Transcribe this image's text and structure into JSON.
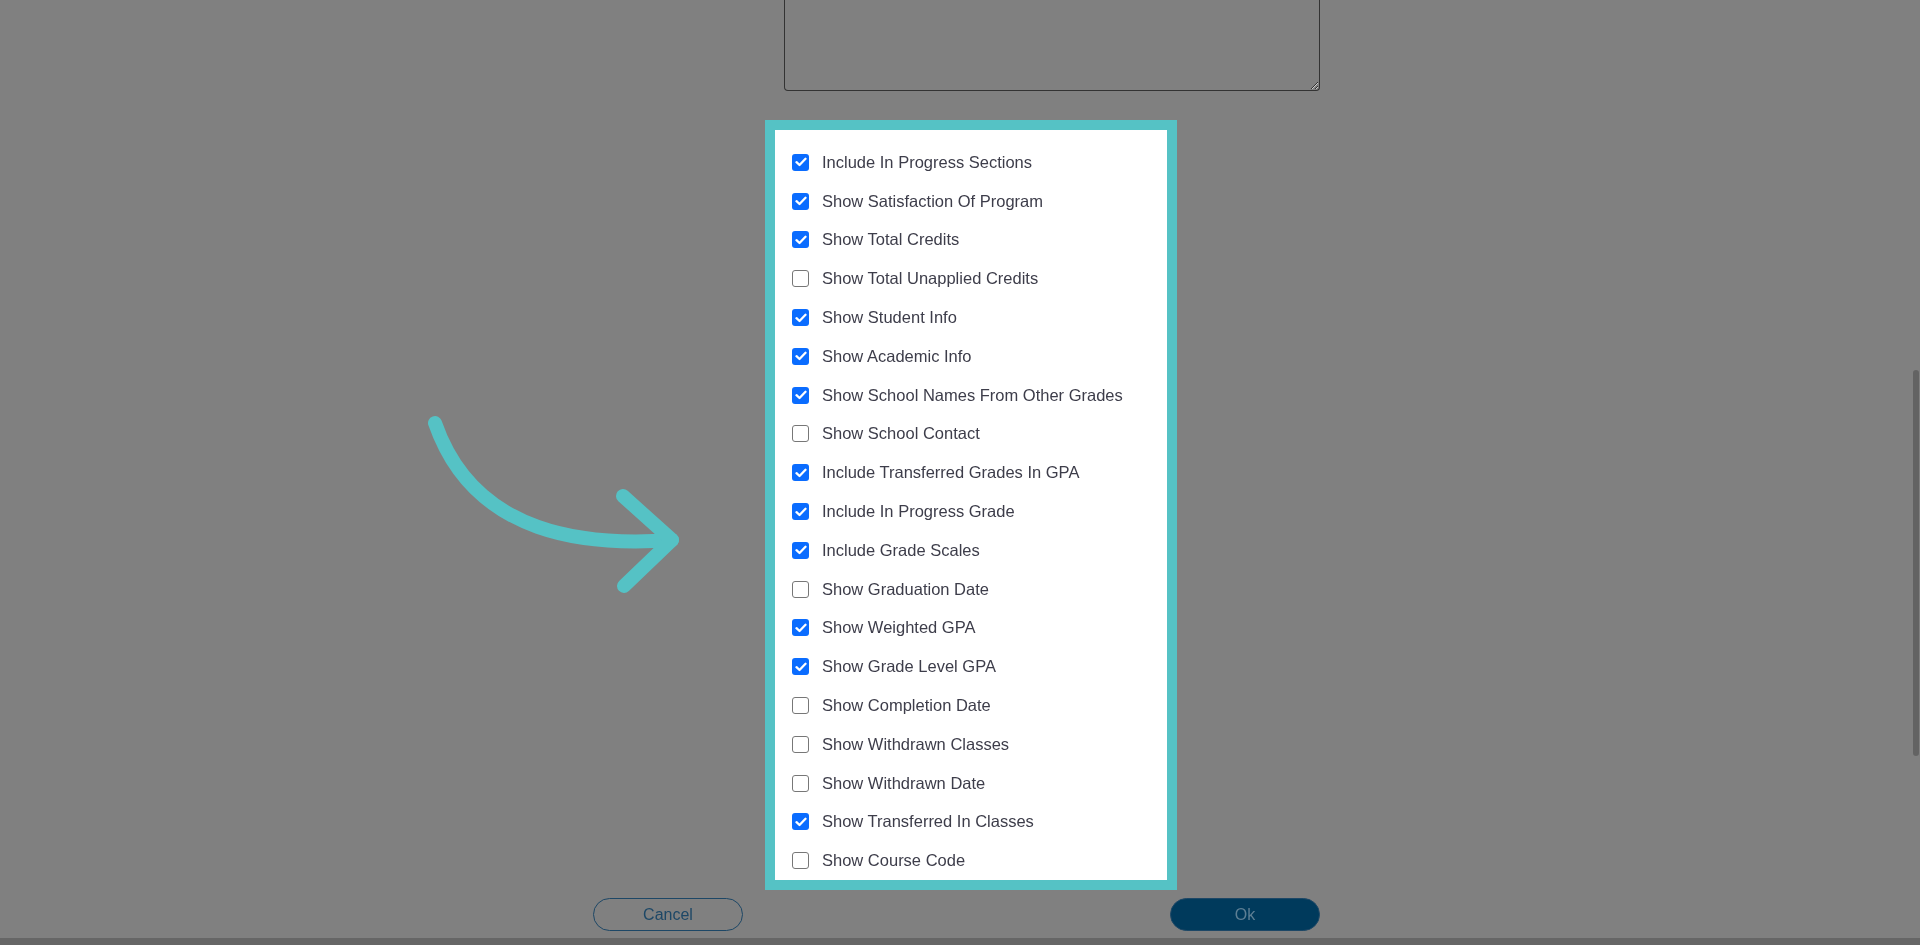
{
  "options": [
    {
      "label": "Include In Progress Sections",
      "checked": true
    },
    {
      "label": "Show Satisfaction Of Program",
      "checked": true
    },
    {
      "label": "Show Total Credits",
      "checked": true
    },
    {
      "label": "Show Total Unapplied Credits",
      "checked": false
    },
    {
      "label": "Show Student Info",
      "checked": true
    },
    {
      "label": "Show Academic Info",
      "checked": true
    },
    {
      "label": "Show School Names From Other Grades",
      "checked": true
    },
    {
      "label": "Show School Contact",
      "checked": false
    },
    {
      "label": "Include Transferred Grades In GPA",
      "checked": true
    },
    {
      "label": "Include In Progress Grade",
      "checked": true
    },
    {
      "label": "Include Grade Scales",
      "checked": true
    },
    {
      "label": "Show Graduation Date",
      "checked": false
    },
    {
      "label": "Show Weighted GPA",
      "checked": true
    },
    {
      "label": "Show Grade Level GPA",
      "checked": true
    },
    {
      "label": "Show Completion Date",
      "checked": false
    },
    {
      "label": "Show Withdrawn Classes",
      "checked": false
    },
    {
      "label": "Show Withdrawn Date",
      "checked": false
    },
    {
      "label": "Show Transferred In Classes",
      "checked": true
    },
    {
      "label": "Show Course Code",
      "checked": false
    }
  ],
  "buttons": [
    {
      "label": "Cancel",
      "kind": "secondary"
    },
    {
      "label": "Ok",
      "kind": "primary"
    }
  ]
}
